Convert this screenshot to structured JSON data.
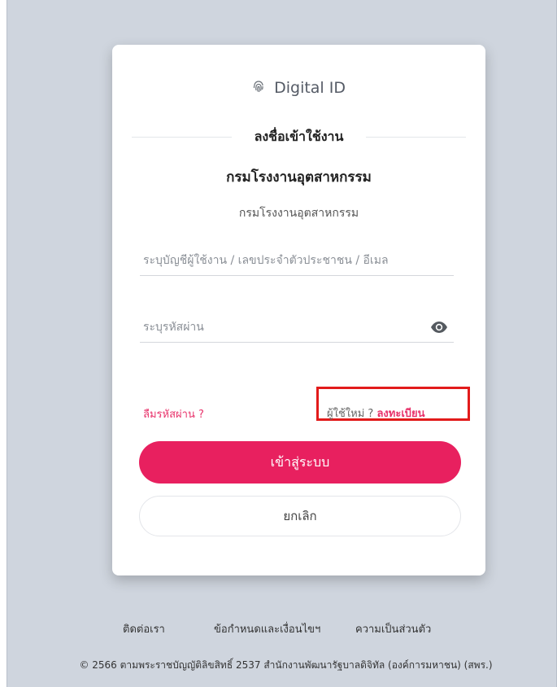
{
  "brand": {
    "name": "Digital ID",
    "icon": "fingerprint-icon"
  },
  "login": {
    "title": "ลงชื่อเข้าใช้งาน",
    "organization": "กรมโรงงานอุตสาหกรรม",
    "organization_sub": "กรมโรงงานอุตสาหกรรม",
    "username_placeholder": "ระบุบัญชีผู้ใช้งาน / เลขประจำตัวประชาชน / อีเมล",
    "password_placeholder": "ระบุรหัสผ่าน",
    "password_toggle_icon": "eye-icon",
    "forgot_password": "ลืมรหัสผ่าน ?",
    "new_user_prefix": "ผู้ใช้ใหม่ ?",
    "register": "ลงทะเบียน",
    "login_button": "เข้าสู่ระบบ",
    "cancel_button": "ยกเลิก"
  },
  "footer": {
    "links": [
      "ติดต่อเรา",
      "ข้อกำหนดและเงื่อนไขฯ",
      "ความเป็นส่วนตัว"
    ],
    "copyright": "© 2566 ตามพระราชบัญญัติลิขสิทธิ์ 2537 สำนักงานพัฒนารัฐบาลดิจิทัล (องค์การมหาชน) (สพร.)"
  },
  "colors": {
    "accent": "#e8205f",
    "highlight_box": "#e21b1b",
    "background": "#cfd5de"
  }
}
